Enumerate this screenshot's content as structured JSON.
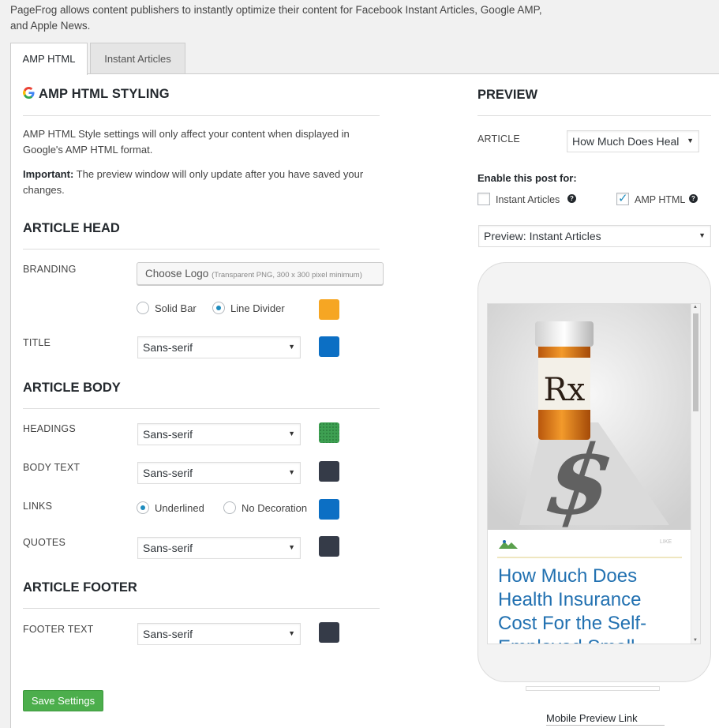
{
  "intro": "PageFrog allows content publishers to instantly optimize their content for Facebook Instant Articles, Google AMP, and Apple News.",
  "tabs": [
    {
      "label": "AMP HTML",
      "active": true
    },
    {
      "label": "Instant Articles",
      "active": false
    }
  ],
  "amp": {
    "title": "AMP HTML STYLING",
    "description": "AMP HTML Style settings will only affect your content when displayed in Google's AMP HTML format.",
    "important_label": "Important:",
    "important_text": "The preview window will only update after you have saved your changes."
  },
  "article_head": {
    "title": "ARTICLE HEAD",
    "branding_label": "BRANDING",
    "choose_logo": "Choose Logo",
    "choose_logo_hint": "(Transparent PNG, 300 x 300 pixel minimum)",
    "solid_bar": "Solid Bar",
    "line_divider": "Line Divider",
    "branding_color": "#f6a623",
    "title_label": "TITLE",
    "title_font": "Sans-serif",
    "title_color": "#0c6fc4"
  },
  "article_body": {
    "title": "ARTICLE BODY",
    "headings_label": "HEADINGS",
    "headings_font": "Sans-serif",
    "headings_color": "#3ea052",
    "body_text_label": "BODY TEXT",
    "body_text_font": "Sans-serif",
    "body_text_color": "#353b48",
    "links_label": "LINKS",
    "underlined": "Underlined",
    "no_decoration": "No Decoration",
    "links_color": "#0c6fc4",
    "quotes_label": "QUOTES",
    "quotes_font": "Sans-serif",
    "quotes_color": "#353b48"
  },
  "article_footer": {
    "title": "ARTICLE FOOTER",
    "footer_text_label": "FOOTER TEXT",
    "footer_text_font": "Sans-serif",
    "footer_text_color": "#353b48"
  },
  "save_button": "Save Settings",
  "preview": {
    "title": "PREVIEW",
    "article_label": "ARTICLE",
    "article_value": "How Much Does Heal",
    "enable_label": "Enable this post for:",
    "instant_articles": "Instant Articles",
    "instant_articles_checked": false,
    "amp_html": "AMP HTML",
    "amp_html_checked": true,
    "mode_value": "Preview: Instant Articles",
    "article_headline": "How Much Does Health Insurance Cost For the Self-Employed Small",
    "like_text": "LIKE",
    "rx_text": "Rx",
    "mobile_link": "Mobile Preview Link"
  }
}
